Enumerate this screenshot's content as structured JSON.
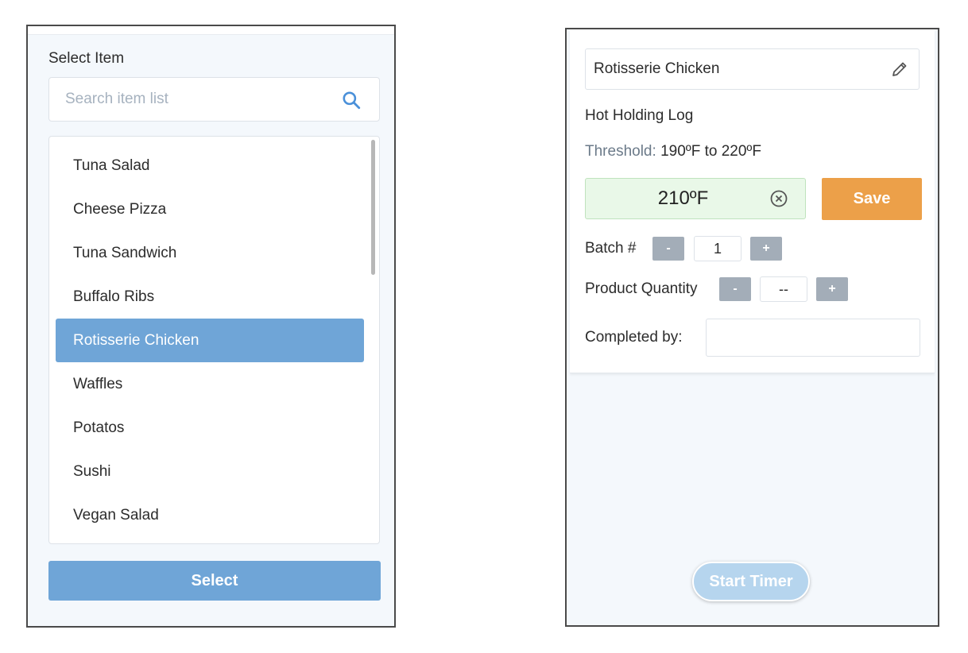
{
  "select_panel": {
    "title": "Select Item",
    "search": {
      "placeholder": "Search item list",
      "value": ""
    },
    "items": [
      {
        "label": "Tuna Salad",
        "selected": false
      },
      {
        "label": "Cheese Pizza",
        "selected": false
      },
      {
        "label": "Tuna Sandwich",
        "selected": false
      },
      {
        "label": "Buffalo Ribs",
        "selected": false
      },
      {
        "label": "Rotisserie Chicken",
        "selected": true
      },
      {
        "label": "Waffles",
        "selected": false
      },
      {
        "label": "Potatos",
        "selected": false
      },
      {
        "label": "Sushi",
        "selected": false
      },
      {
        "label": "Vegan Salad",
        "selected": false
      }
    ],
    "select_label": "Select"
  },
  "log_panel": {
    "item_name": "Rotisserie Chicken",
    "log_title": "Hot Holding Log",
    "threshold_label": "Threshold:",
    "threshold_value": "190ºF to 220ºF",
    "temperature": "210ºF",
    "save_label": "Save",
    "batch": {
      "label": "Batch #",
      "minus": "-",
      "value": "1",
      "plus": "+"
    },
    "quantity": {
      "label": "Product Quantity",
      "minus": "-",
      "value": "--",
      "plus": "+"
    },
    "completed_by": {
      "label": "Completed by:",
      "value": ""
    },
    "start_timer_label": "Start Timer"
  },
  "colors": {
    "accent_blue": "#6fa5d7",
    "save_orange": "#eca049",
    "temp_ok_green": "#e9f8e8",
    "stepper_gray": "#a3adb8",
    "timer_disabled": "#b6d5ee"
  },
  "icons": {
    "search": "search-icon",
    "edit": "pencil-icon",
    "clear": "clear-circle-x-icon"
  }
}
